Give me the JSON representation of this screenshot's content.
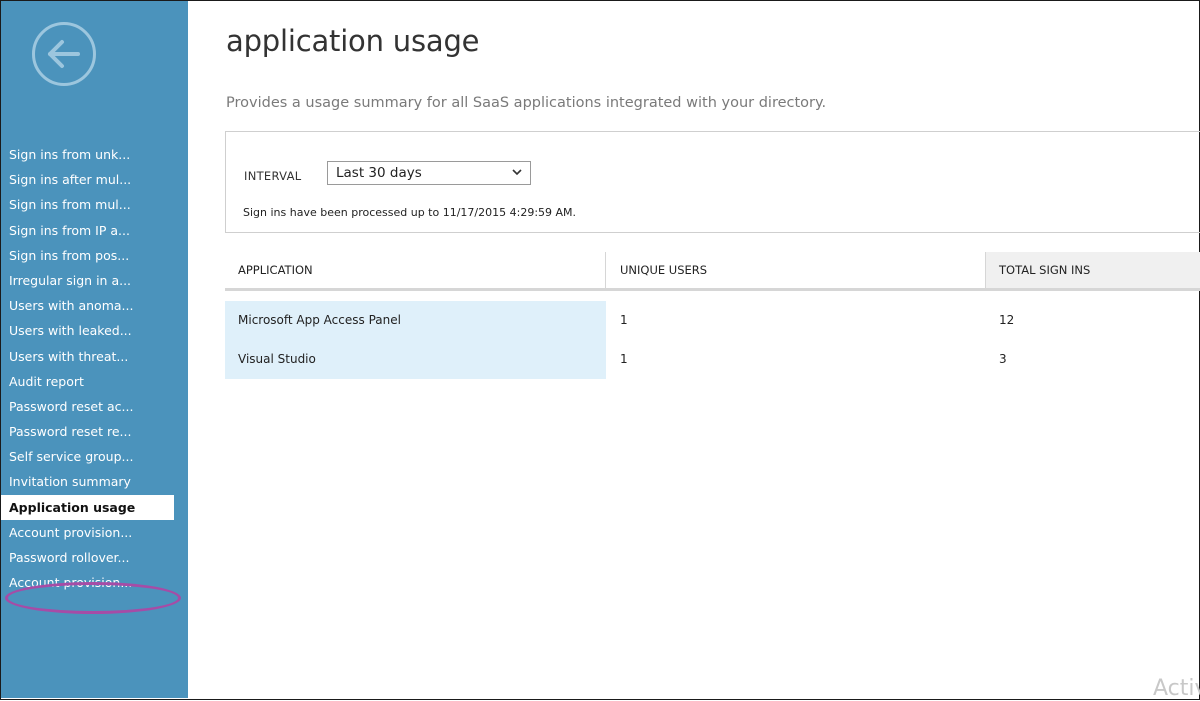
{
  "sidebar": {
    "back_label": "",
    "items": [
      {
        "label": "Sign ins from unk..."
      },
      {
        "label": "Sign ins after mul..."
      },
      {
        "label": "Sign ins from mul..."
      },
      {
        "label": "Sign ins from IP a..."
      },
      {
        "label": "Sign ins from pos..."
      },
      {
        "label": "Irregular sign in a..."
      },
      {
        "label": "Users with anoma..."
      },
      {
        "label": "Users with leaked..."
      },
      {
        "label": "Users with threat..."
      },
      {
        "label": "Audit report"
      },
      {
        "label": "Password reset ac..."
      },
      {
        "label": "Password reset re..."
      },
      {
        "label": "Self service group..."
      },
      {
        "label": "Invitation summary"
      },
      {
        "label": "Application usage"
      },
      {
        "label": "Account provision..."
      },
      {
        "label": "Password rollover..."
      },
      {
        "label": "Account provision..."
      }
    ],
    "active_index": 14
  },
  "main": {
    "title": "application usage",
    "description": "Provides a usage summary for all SaaS applications integrated with your directory.",
    "filter": {
      "interval_label": "INTERVAL",
      "interval_value": "Last 30 days",
      "processed_note": "Sign ins have been processed up to 11/17/2015 4:29:59 AM."
    },
    "table": {
      "headers": [
        "APPLICATION",
        "UNIQUE USERS",
        "TOTAL SIGN INS"
      ],
      "rows": [
        [
          "Microsoft App Access Panel",
          "1",
          "12"
        ],
        [
          "Visual Studio",
          "1",
          "3"
        ]
      ]
    }
  },
  "watermark": "Activ",
  "colors": {
    "sidebar_bg": "#4b93bc",
    "highlight_ring": "#a64ca6",
    "row_highlight": "#dff0fa"
  }
}
